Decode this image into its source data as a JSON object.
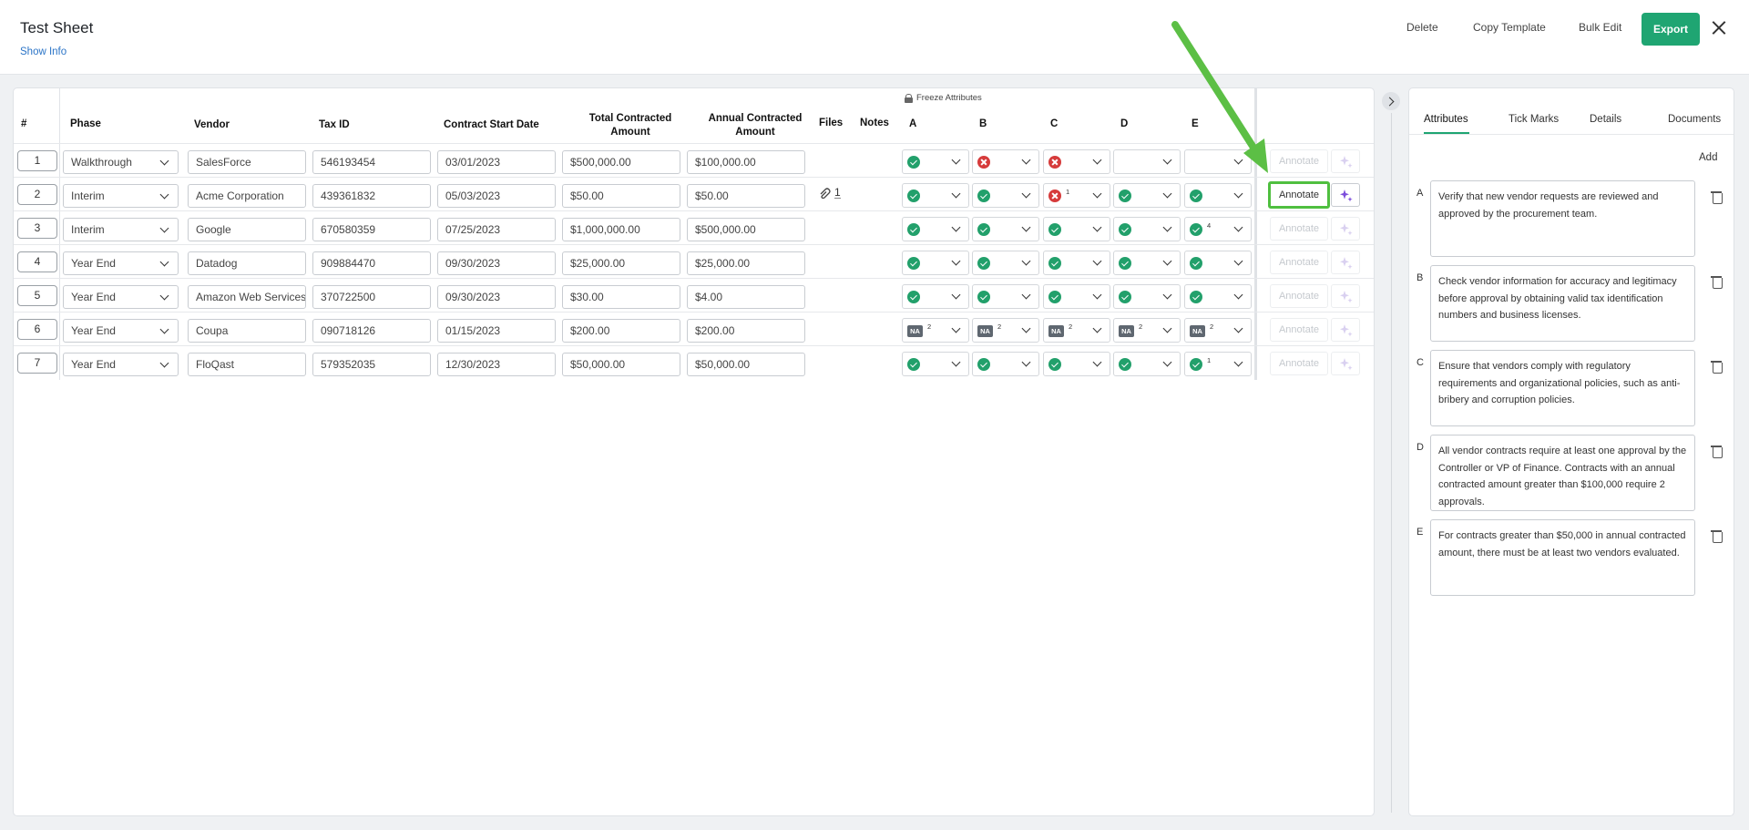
{
  "header": {
    "title": "Test Sheet",
    "show_info": "Show Info",
    "actions": {
      "delete": "Delete",
      "copy_template": "Copy Template",
      "bulk_edit": "Bulk Edit",
      "export": "Export"
    }
  },
  "table": {
    "headers": {
      "num": "#",
      "phase": "Phase",
      "vendor": "Vendor",
      "tax_id": "Tax ID",
      "start_date": "Contract Start Date",
      "total_line1": "Total Contracted",
      "total_line2": "Amount",
      "annual_line1": "Annual Contracted",
      "annual_line2": "Amount",
      "files": "Files",
      "notes": "Notes",
      "freeze": "Freeze Attributes",
      "attr_a": "A",
      "attr_b": "B",
      "attr_c": "C",
      "attr_d": "D",
      "attr_e": "E"
    },
    "annotate_label": "Annotate",
    "rows": [
      {
        "num": "1",
        "phase": "Walkthrough",
        "vendor": "SalesForce",
        "tax_id": "546193454",
        "start": "03/01/2023",
        "total": "$500,000.00",
        "annual": "$100,000.00",
        "files": ""
      },
      {
        "num": "2",
        "phase": "Interim",
        "vendor": "Acme Corporation",
        "tax_id": "439361832",
        "start": "05/03/2023",
        "total": "$50.00",
        "annual": "$50.00",
        "files": "1"
      },
      {
        "num": "3",
        "phase": "Interim",
        "vendor": "Google",
        "tax_id": "670580359",
        "start": "07/25/2023",
        "total": "$1,000,000.00",
        "annual": "$500,000.00",
        "files": ""
      },
      {
        "num": "4",
        "phase": "Year End",
        "vendor": "Datadog",
        "tax_id": "909884470",
        "start": "09/30/2023",
        "total": "$25,000.00",
        "annual": "$25,000.00",
        "files": ""
      },
      {
        "num": "5",
        "phase": "Year End",
        "vendor": "Amazon Web Services",
        "tax_id": "370722500",
        "start": "09/30/2023",
        "total": "$30.00",
        "annual": "$4.00",
        "files": ""
      },
      {
        "num": "6",
        "phase": "Year End",
        "vendor": "Coupa",
        "tax_id": "090718126",
        "start": "01/15/2023",
        "total": "$200.00",
        "annual": "$200.00",
        "files": ""
      },
      {
        "num": "7",
        "phase": "Year End",
        "vendor": "FloQast",
        "tax_id": "579352035",
        "start": "12/30/2023",
        "total": "$50,000.00",
        "annual": "$50,000.00",
        "files": ""
      }
    ],
    "attribute_status": [
      [
        {
          "s": "ok",
          "n": ""
        },
        {
          "s": "bad",
          "n": ""
        },
        {
          "s": "bad",
          "n": ""
        },
        {
          "s": "empty",
          "n": ""
        },
        {
          "s": "empty",
          "n": ""
        }
      ],
      [
        {
          "s": "ok",
          "n": ""
        },
        {
          "s": "ok",
          "n": ""
        },
        {
          "s": "bad",
          "n": "1"
        },
        {
          "s": "ok",
          "n": ""
        },
        {
          "s": "ok",
          "n": ""
        }
      ],
      [
        {
          "s": "ok",
          "n": ""
        },
        {
          "s": "ok",
          "n": ""
        },
        {
          "s": "ok",
          "n": ""
        },
        {
          "s": "ok",
          "n": ""
        },
        {
          "s": "ok",
          "n": "4"
        }
      ],
      [
        {
          "s": "ok",
          "n": ""
        },
        {
          "s": "ok",
          "n": ""
        },
        {
          "s": "ok",
          "n": ""
        },
        {
          "s": "ok",
          "n": ""
        },
        {
          "s": "ok",
          "n": ""
        }
      ],
      [
        {
          "s": "ok",
          "n": ""
        },
        {
          "s": "ok",
          "n": ""
        },
        {
          "s": "ok",
          "n": ""
        },
        {
          "s": "ok",
          "n": ""
        },
        {
          "s": "ok",
          "n": ""
        }
      ],
      [
        {
          "s": "na",
          "n": "2"
        },
        {
          "s": "na",
          "n": "2"
        },
        {
          "s": "na",
          "n": "2"
        },
        {
          "s": "na",
          "n": "2"
        },
        {
          "s": "na",
          "n": "2"
        }
      ],
      [
        {
          "s": "ok",
          "n": ""
        },
        {
          "s": "ok",
          "n": ""
        },
        {
          "s": "ok",
          "n": ""
        },
        {
          "s": "ok",
          "n": ""
        },
        {
          "s": "ok",
          "n": "1"
        }
      ]
    ],
    "na_label": "NA"
  },
  "sidebar": {
    "tabs": [
      "Attributes",
      "Tick Marks",
      "Details",
      "Documents"
    ],
    "add_label": "Add",
    "attributes": [
      {
        "letter": "A",
        "text": "Verify that new vendor requests are reviewed and approved by the procurement team."
      },
      {
        "letter": "B",
        "text": "Check vendor information for accuracy and legitimacy before approval by obtaining valid tax identification numbers and business licenses."
      },
      {
        "letter": "C",
        "text": "Ensure that vendors comply with regulatory requirements and organizational policies, such as anti-bribery and corruption policies."
      },
      {
        "letter": "D",
        "text": "All vendor contracts require at least one approval by the Controller or VP of Finance. Contracts with an annual contracted amount greater than $100,000 require 2 approvals."
      },
      {
        "letter": "E",
        "text": "For contracts greater than $50,000 in annual contracted amount, there must be at least two vendors evaluated."
      }
    ]
  },
  "colors": {
    "accent": "#1fa572",
    "highlight": "#4fbf3f",
    "ok": "#22a06b",
    "bad": "#d63b3b",
    "link": "#2b74c7"
  }
}
